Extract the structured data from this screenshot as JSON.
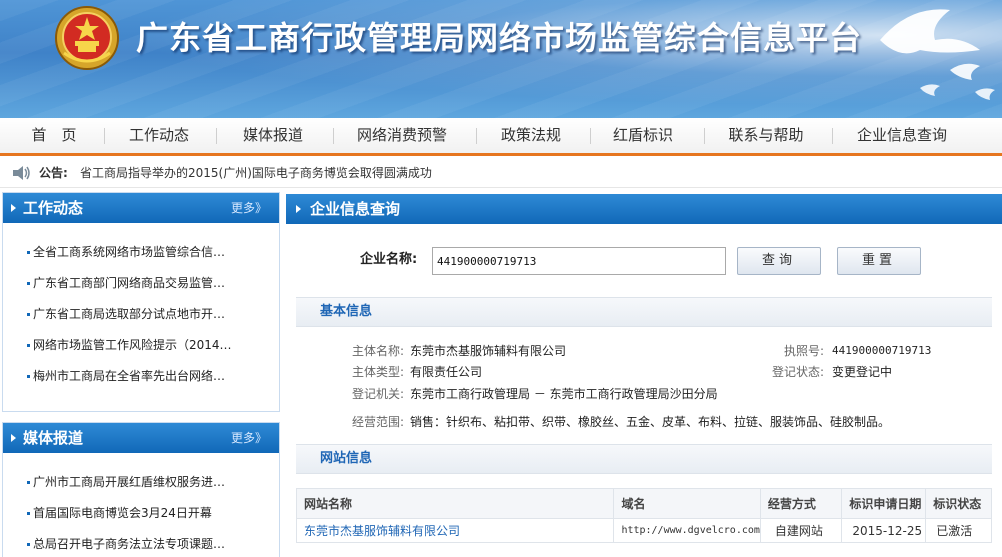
{
  "banner": {
    "title": "广东省工商行政管理局网络市场监管综合信息平台"
  },
  "nav": {
    "items": [
      "首　页",
      "工作动态",
      "媒体报道",
      "网络消费预警",
      "政策法规",
      "红盾标识",
      "联系与帮助",
      "企业信息查询"
    ]
  },
  "notice": {
    "label": "公告:",
    "text": "省工商局指导举办的2015(广州)国际电子商务博览会取得圆满成功"
  },
  "sidebar": {
    "work": {
      "title": "工作动态",
      "more": "更多》",
      "items": [
        "全省工商系统网络市场监管综合信…",
        "广东省工商部门网络商品交易监管…",
        "广东省工商局选取部分试点地市开…",
        "网络市场监管工作风险提示（2014…",
        "梅州市工商局在全省率先出台网络…"
      ]
    },
    "media": {
      "title": "媒体报道",
      "more": "更多》",
      "items": [
        "广州市工商局开展红盾维权服务进…",
        "首届国际电商博览会3月24日开幕",
        "总局召开电子商务法立法专项课题…"
      ]
    }
  },
  "main": {
    "title": "企业信息查询",
    "search": {
      "label": "企业名称:",
      "value": "441900000719713",
      "query_button": "查询",
      "reset_button": "重置"
    },
    "basic": {
      "title": "基本信息",
      "name_label": "主体名称:",
      "name_value": "东莞市杰基服饰辅料有限公司",
      "license_label": "执照号:",
      "license_value": "441900000719713",
      "type_label": "主体类型:",
      "type_value": "有限责任公司",
      "status_label": "登记状态:",
      "status_value": "变更登记中",
      "authority_label": "登记机关:",
      "authority_value": "东莞市工商行政管理局 － 东莞市工商行政管理局沙田分局",
      "scope_label": "经营范围:",
      "scope_value": "销售：针织布、粘扣带、织带、橡胶丝、五金、皮革、布料、拉链、服装饰品、硅胶制品。"
    },
    "website": {
      "title": "网站信息",
      "columns": [
        "网站名称",
        "域名",
        "经营方式",
        "标识申请日期",
        "标识状态"
      ],
      "rows": [
        [
          "东莞市杰基服饰辅料有限公司",
          "http://www.dgvelcro.com",
          "自建网站",
          "2015-12-25",
          "已激活"
        ]
      ]
    }
  },
  "colors": {
    "banner_blue": "#3f82c8",
    "nav_accent": "#e6761f",
    "panel_blue": "#1168b8",
    "section_title": "#1f66b5"
  },
  "icons": {
    "emblem": "national-emblem-icon",
    "notice": "speaker-icon",
    "decoration": "dove-icon"
  }
}
